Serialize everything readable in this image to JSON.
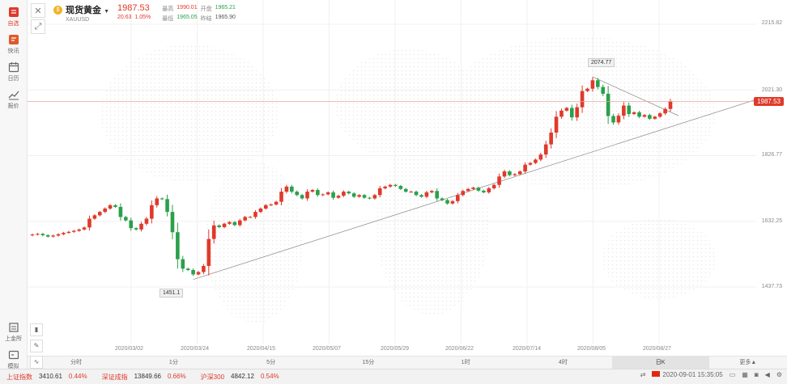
{
  "sidebar": {
    "items": [
      {
        "label": "自选",
        "icon": "watchlist-icon",
        "active": true
      },
      {
        "label": "快讯",
        "icon": "news-icon",
        "active": false
      },
      {
        "label": "日历",
        "icon": "calendar-icon",
        "active": false
      },
      {
        "label": "报价",
        "icon": "quote-icon",
        "active": false
      },
      {
        "label": "上金所",
        "icon": "sge-icon",
        "active": false
      },
      {
        "label": "模拟",
        "icon": "simulate-icon",
        "active": false
      }
    ]
  },
  "header": {
    "name": "现货黄金",
    "code": "XAUUSD",
    "price": "1987.53",
    "change": "20.63",
    "change_pct": "1.05%",
    "stats": [
      {
        "k": "最高",
        "v": "1990.01",
        "c": "red"
      },
      {
        "k": "开盘",
        "v": "1965.21",
        "c": "green"
      },
      {
        "k": "最低",
        "v": "1965.05",
        "c": "green"
      },
      {
        "k": "昨结",
        "v": "1965.90",
        "c": "dark"
      }
    ]
  },
  "annotations": {
    "high": "2074.77",
    "low": "1451.1"
  },
  "periods": [
    "分时",
    "1分",
    "5分",
    "15分",
    "1时",
    "4时",
    "日K",
    "更多▲"
  ],
  "active_period": "日K",
  "statusbar": {
    "indices": [
      {
        "name": "上证指数",
        "value": "3410.61",
        "pct": "0.44%"
      },
      {
        "name": "深证成指",
        "value": "13849.66",
        "pct": "0.66%"
      },
      {
        "name": "沪深300",
        "value": "4842.12",
        "pct": "0.54%"
      }
    ],
    "datetime": "2020-09-01 15:35:05"
  },
  "colors": {
    "up": "#e0392b",
    "down": "#2aa04a"
  },
  "chart_data": {
    "type": "candlestick",
    "y_ticks": [
      "2215.82",
      "2021.30",
      "1826.77",
      "1632.25",
      "1437.73"
    ],
    "ylim": [
      1437.73,
      2215.82
    ],
    "current_price": "1987.53",
    "x_ticks": [
      "2020/03/02",
      "2020/03/24",
      "2020/04/15",
      "2020/05/07",
      "2020/05/29",
      "2020/06/22",
      "2020/07/14",
      "2020/08/05",
      "2020/08/27"
    ],
    "closes": [
      1593,
      1595,
      1591,
      1587,
      1590,
      1594,
      1598,
      1601,
      1604,
      1608,
      1614,
      1640,
      1650,
      1660,
      1670,
      1680,
      1675,
      1645,
      1635,
      1612,
      1608,
      1625,
      1640,
      1680,
      1700,
      1698,
      1660,
      1600,
      1520,
      1492,
      1488,
      1475,
      1482,
      1500,
      1580,
      1620,
      1615,
      1625,
      1630,
      1621,
      1635,
      1645,
      1645,
      1660,
      1670,
      1680,
      1682,
      1690,
      1720,
      1735,
      1720,
      1710,
      1700,
      1720,
      1725,
      1710,
      1712,
      1718,
      1702,
      1708,
      1720,
      1715,
      1705,
      1710,
      1702,
      1700,
      1710,
      1730,
      1735,
      1740,
      1737,
      1728,
      1720,
      1720,
      1710,
      1705,
      1718,
      1722,
      1700,
      1695,
      1685,
      1692,
      1710,
      1722,
      1728,
      1732,
      1723,
      1718,
      1730,
      1740,
      1765,
      1780,
      1769,
      1772,
      1780,
      1800,
      1805,
      1815,
      1830,
      1860,
      1895,
      1942,
      1960,
      1968,
      1940,
      1970,
      2018,
      2025,
      2050,
      2030,
      2010,
      1944,
      1925,
      1945,
      1975,
      1950,
      1955,
      1942,
      1947,
      1936,
      1942,
      1952,
      1965,
      1987
    ]
  }
}
